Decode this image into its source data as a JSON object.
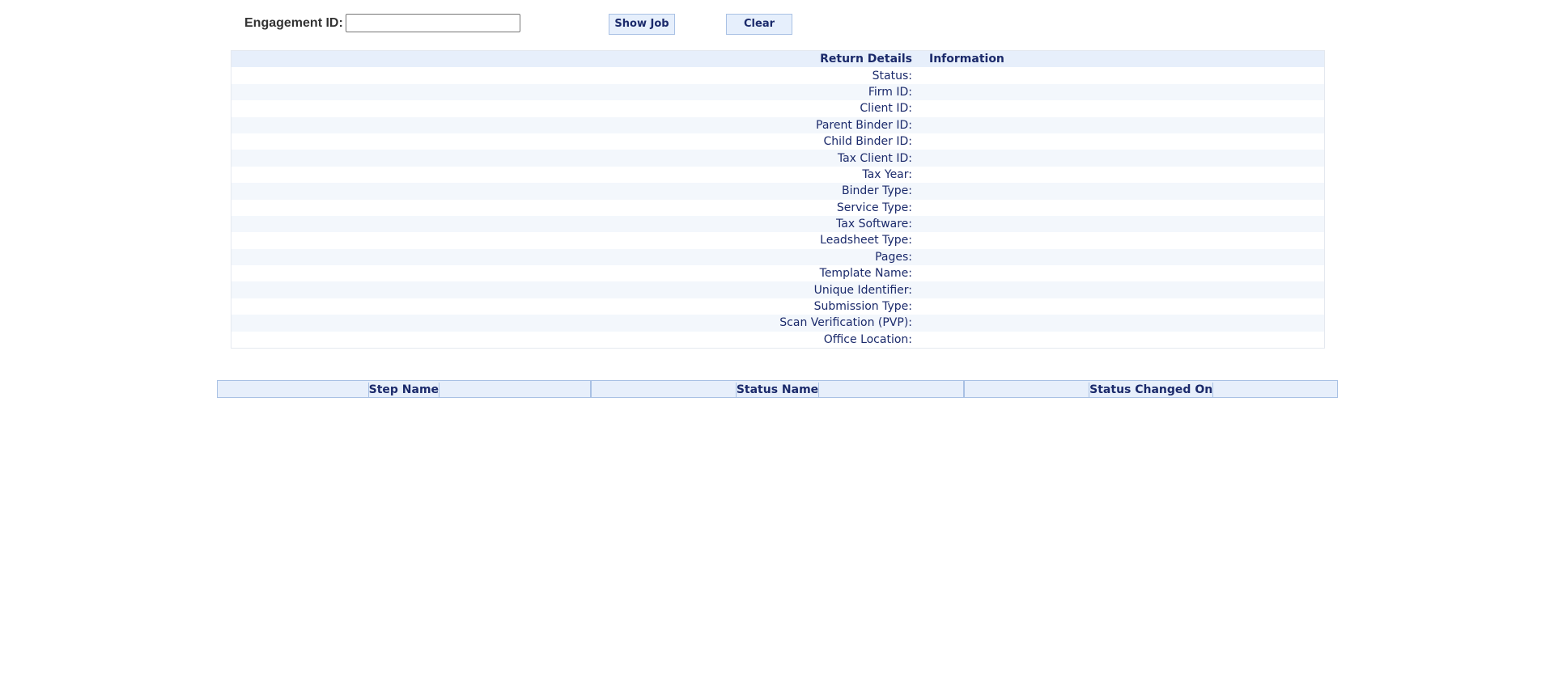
{
  "search": {
    "label": "Engagement ID:",
    "value": "",
    "placeholder": ""
  },
  "buttons": {
    "show_job": "Show Job",
    "clear": "Clear"
  },
  "details": {
    "header": {
      "label": "Return Details",
      "value": "Information"
    },
    "rows": [
      {
        "label": "Status:",
        "value": ""
      },
      {
        "label": "Firm ID:",
        "value": ""
      },
      {
        "label": "Client ID:",
        "value": ""
      },
      {
        "label": "Parent Binder ID:",
        "value": ""
      },
      {
        "label": "Child Binder ID:",
        "value": ""
      },
      {
        "label": "Tax Client ID:",
        "value": ""
      },
      {
        "label": "Tax Year:",
        "value": ""
      },
      {
        "label": "Binder Type:",
        "value": ""
      },
      {
        "label": "Service Type:",
        "value": ""
      },
      {
        "label": "Tax Software:",
        "value": ""
      },
      {
        "label": "Leadsheet Type:",
        "value": ""
      },
      {
        "label": "Pages:",
        "value": ""
      },
      {
        "label": "Template Name:",
        "value": ""
      },
      {
        "label": "Unique Identifier:",
        "value": ""
      },
      {
        "label": "Submission Type:",
        "value": ""
      },
      {
        "label": "Scan Verification (PVP):",
        "value": ""
      },
      {
        "label": "Office Location:",
        "value": ""
      }
    ]
  },
  "steps": {
    "columns": [
      "Step Name",
      "Status Name",
      "Status Changed On"
    ]
  },
  "colors": {
    "header_bg": "#e7effb",
    "row_alt_bg": "#f3f7fc",
    "text": "#1b2a6b",
    "border": "#a9c1e4"
  }
}
